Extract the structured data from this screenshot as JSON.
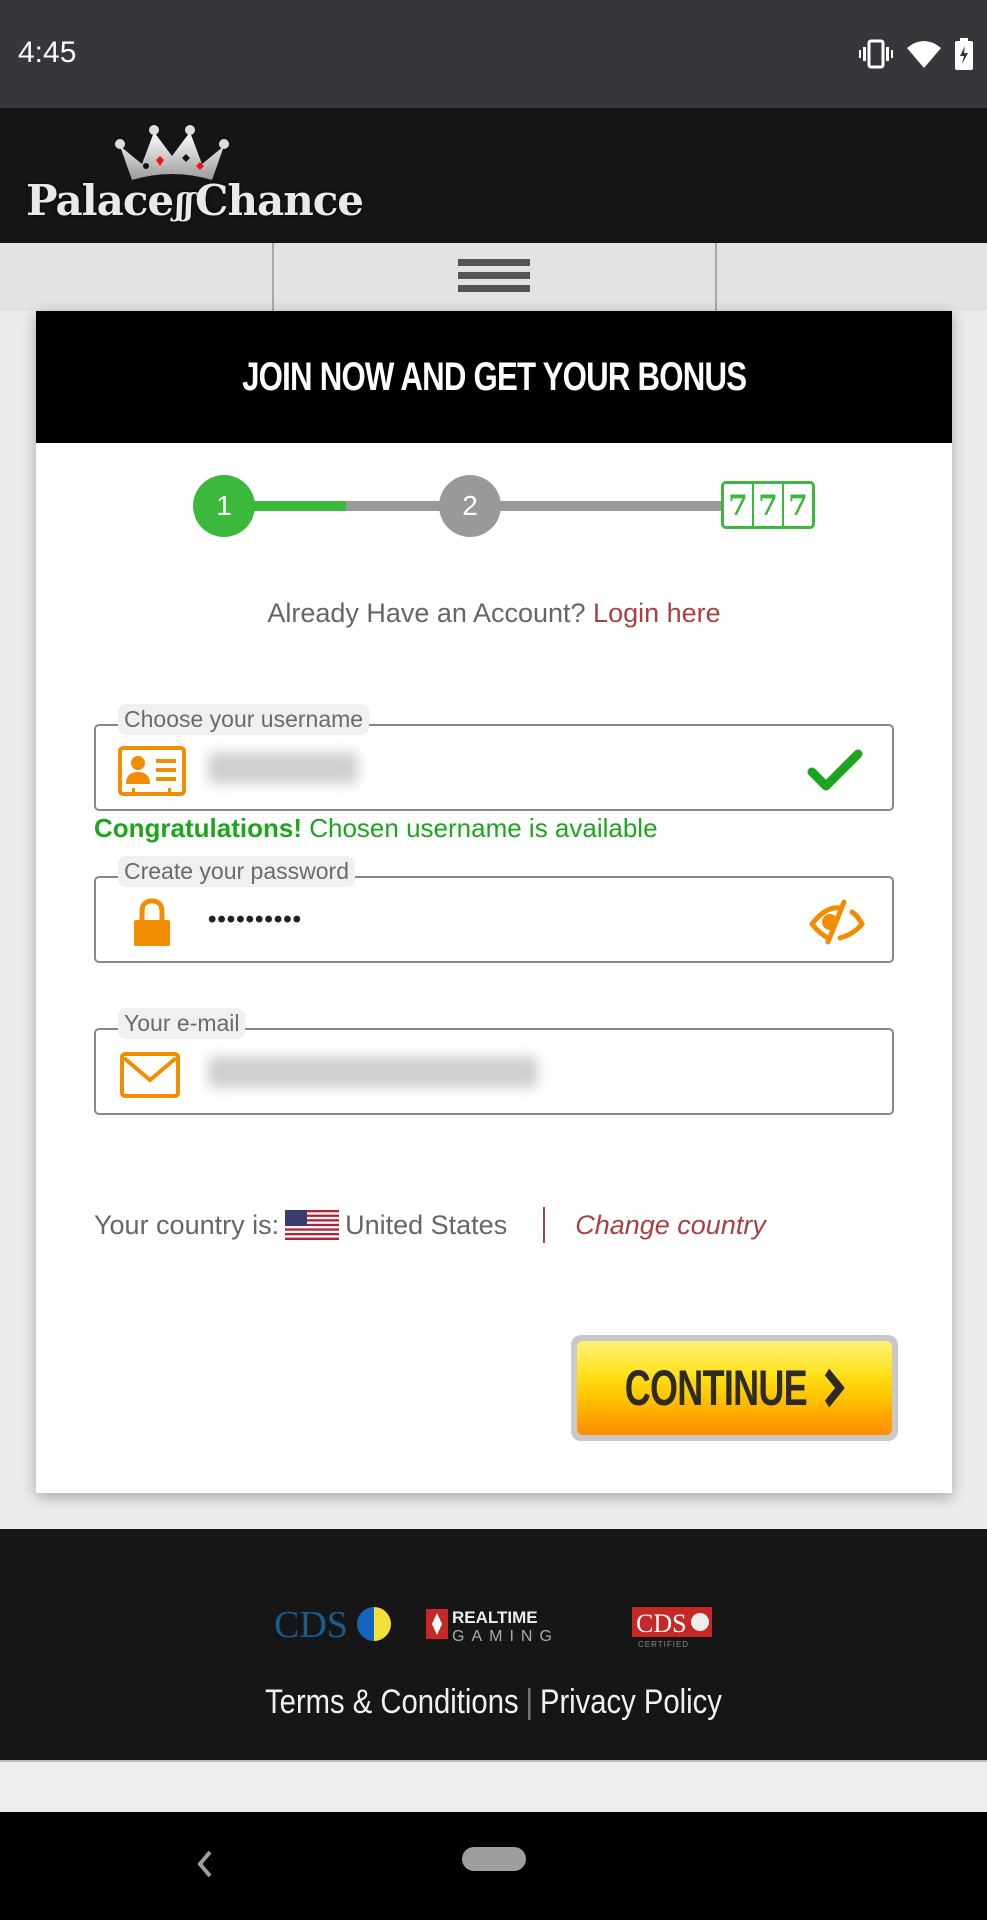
{
  "status_bar": {
    "time": "4:45",
    "icons": [
      "vibrate-icon",
      "wifi-icon",
      "battery-charging-icon"
    ]
  },
  "header": {
    "logo_text": "Palace of Chance",
    "logo_text_part1": "Palace",
    "logo_text_part2": "Chance",
    "menu_icon": "hamburger-menu-icon"
  },
  "card": {
    "title": "JOIN NOW AND GET YOUR BONUS",
    "stepper": {
      "steps": [
        "1",
        "2"
      ],
      "current_step": 1,
      "segment1_progress": 0.5,
      "final_icon": "slot-777-icon",
      "slot_digits": [
        "7",
        "7",
        "7"
      ]
    },
    "login_prompt": "Already Have an Account?",
    "login_link": "Login here",
    "fields": {
      "username": {
        "label": "Choose your username",
        "value": "(blurred)",
        "icon": "id-card-icon",
        "status_icon": "checkmark-icon"
      },
      "password": {
        "label": "Create your password",
        "value": "••••••••••",
        "icon": "lock-icon",
        "toggle_icon": "eye-slash-icon"
      },
      "email": {
        "label": "Your e-mail",
        "value": "(blurred)",
        "icon": "envelope-icon"
      }
    },
    "username_status": {
      "strong": "Congratulations!",
      "text": "Chosen username is available"
    },
    "country": {
      "prefix": "Your country is:",
      "name": "United States",
      "flag_icon": "us-flag-icon",
      "change_link": "Change country"
    },
    "continue_label": "CONTINUE",
    "continue_icon": "chevron-right-icon"
  },
  "footer": {
    "partners": [
      "CDS",
      "REALTIME GAMING",
      "CDS Certified"
    ],
    "links": {
      "terms": "Terms & Conditions",
      "separator": "|",
      "privacy": "Privacy Policy"
    }
  },
  "colors": {
    "accent_green": "#3cb83c",
    "success_text": "#1ea51e",
    "link_red": "#a84242",
    "icon_orange": "#f28c00",
    "button_yellow": "#ffd200"
  }
}
